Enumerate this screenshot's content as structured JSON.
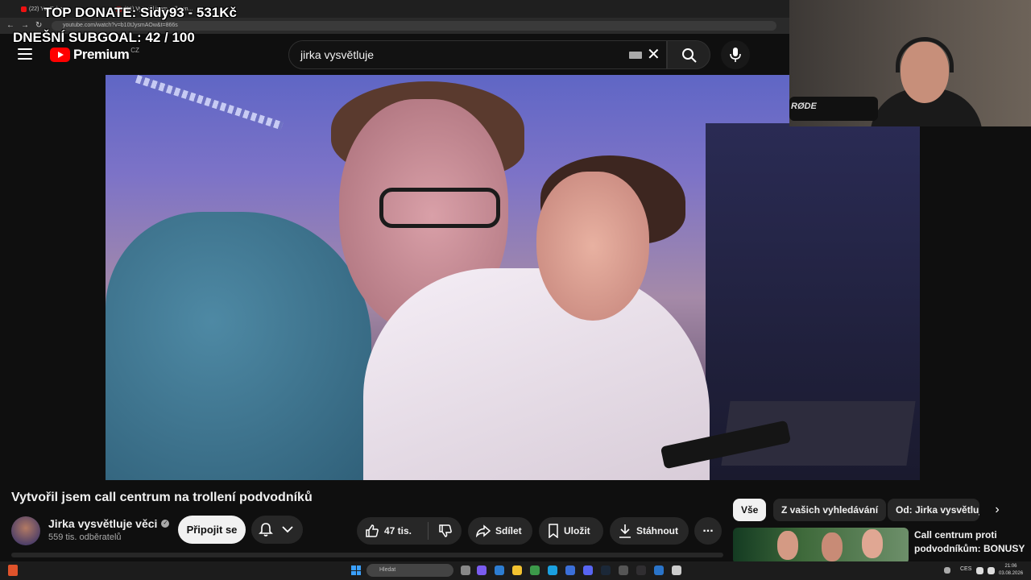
{
  "browser": {
    "tabs": [
      {
        "title": "(22) YouTube"
      },
      {
        "title": "(22) Vytvořil jsem call cen..."
      }
    ],
    "url": "youtube.com/watch?v=b10tJysmAOw&t=866s"
  },
  "overlay": {
    "top_donate": "TOP DONATE: Sidy93 - 531Kč",
    "subgoal_label": "DNEŠNÍ SUBGOAL:",
    "subgoal_value": "42 / 100"
  },
  "header": {
    "logo_text": "Premium",
    "country": "CZ",
    "search_query": "jirka vysvětluje",
    "clear_symbol": "✕",
    "icons": [
      "hamburger-icon",
      "youtube-logo-icon",
      "keyboard-icon",
      "search-icon",
      "mic-icon"
    ]
  },
  "webcam": {
    "mic_brand": "RØDE"
  },
  "video": {
    "title": "Vytvořil jsem call centrum na trollení podvodníků",
    "channel_name": "Jirka vysvětluje věci",
    "verified_symbol": "✓",
    "subscribers": "559 tis. odběratelů",
    "join_label": "Připojit se",
    "actions": {
      "likes": "47 tis.",
      "share": "Sdílet",
      "save": "Uložit",
      "download": "Stáhnout",
      "more": "..."
    }
  },
  "sidebar": {
    "chips": [
      {
        "label": "Vše",
        "active": true
      },
      {
        "label": "Z vašich vyhledávání",
        "active": false
      },
      {
        "label": "Od: Jirka vysvětluje",
        "active": false
      }
    ],
    "chip_next": "›",
    "recommendation": {
      "title": "Call centrum proti podvodníkům: BONUSY"
    }
  },
  "taskbar": {
    "search_placeholder": "Hledat",
    "language": "CES",
    "time": "21:06",
    "date": "03.08.2026"
  }
}
